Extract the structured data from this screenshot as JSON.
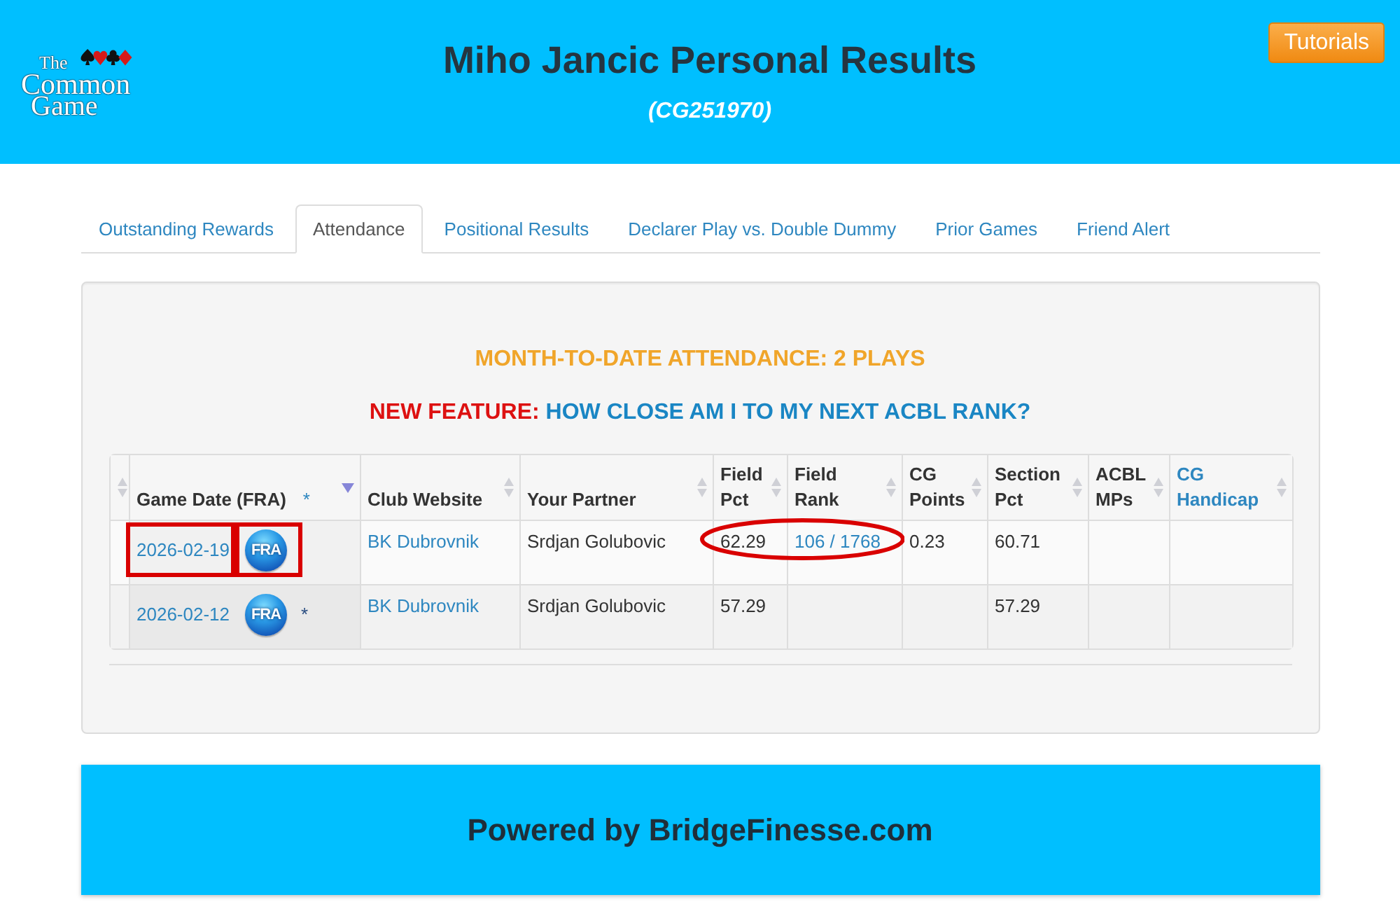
{
  "header": {
    "logo_lines": [
      "The",
      "Common",
      "Game"
    ],
    "title": "Miho Jancic Personal Results",
    "subtitle": "(CG251970)",
    "tutorials_button": "Tutorials"
  },
  "tabs": [
    {
      "label": "Outstanding Rewards",
      "selected": false
    },
    {
      "label": "Attendance",
      "selected": true
    },
    {
      "label": "Positional Results",
      "selected": false
    },
    {
      "label": "Declarer Play vs. Double Dummy",
      "selected": false
    },
    {
      "label": "Prior Games",
      "selected": false
    },
    {
      "label": "Friend Alert",
      "selected": false
    }
  ],
  "attendance": {
    "summary": "MONTH-TO-DATE ATTENDANCE: 2 PLAYS",
    "feature_label": "NEW FEATURE:",
    "feature_link": "HOW CLOSE AM I TO MY NEXT ACBL RANK?"
  },
  "table": {
    "columns": [
      {
        "kind": "blank",
        "sorted": false
      },
      {
        "kind": "text",
        "label": "Game Date (FRA)",
        "note": "*",
        "sorted": true
      },
      {
        "kind": "text",
        "label": "Club Website",
        "sorted": false
      },
      {
        "kind": "text",
        "label": "Your Partner",
        "sorted": false
      },
      {
        "kind": "text",
        "label": "Field Pct",
        "sorted": false
      },
      {
        "kind": "text",
        "label": "Field Rank",
        "sorted": false
      },
      {
        "kind": "text",
        "label": "CG Points",
        "sorted": false
      },
      {
        "kind": "text",
        "label": "Section Pct",
        "sorted": false
      },
      {
        "kind": "text",
        "label": "ACBL MPs",
        "sorted": false
      },
      {
        "kind": "link",
        "label": "CG Handicap",
        "sorted": false
      }
    ],
    "rows": [
      {
        "cells": [
          "",
          {
            "kind": "date",
            "text": "2026-02-19",
            "boxed": true,
            "badge": {
              "text": "FRA",
              "boxed": true
            }
          },
          {
            "kind": "link",
            "text": "BK Dubrovnik",
            "circled": false
          },
          {
            "kind": "text",
            "text": "Srdjan Golubovic",
            "circled": false
          },
          {
            "kind": "text",
            "text": "62.29",
            "circled": true
          },
          {
            "kind": "link",
            "text": "106 / 1768",
            "circled": true
          },
          {
            "kind": "text",
            "text": "0.23",
            "circled": false
          },
          {
            "kind": "text",
            "text": "60.71",
            "circled": false
          },
          "",
          ""
        ]
      },
      {
        "cells": [
          "",
          {
            "kind": "date",
            "text": "2026-02-12",
            "boxed": false,
            "badge": {
              "text": "FRA",
              "boxed": false
            },
            "note": "*"
          },
          {
            "kind": "link",
            "text": "BK Dubrovnik",
            "circled": false
          },
          {
            "kind": "text",
            "text": "Srdjan Golubovic",
            "circled": false
          },
          {
            "kind": "text",
            "text": "57.29",
            "circled": false
          },
          "",
          "",
          {
            "kind": "text",
            "text": "57.29",
            "circled": false
          },
          "",
          ""
        ]
      }
    ]
  },
  "footer": {
    "text": "Powered by BridgeFinesse.com"
  }
}
